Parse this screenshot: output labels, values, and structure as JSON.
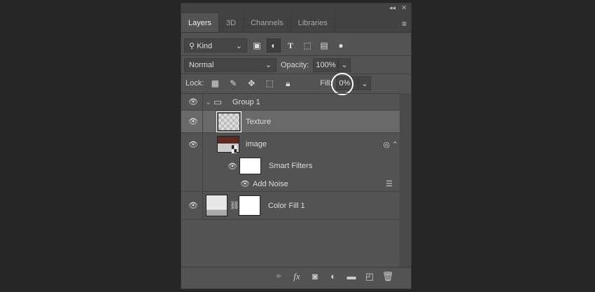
{
  "tabs": [
    "Layers",
    "3D",
    "Channels",
    "Libraries"
  ],
  "filter": {
    "kind_label": "Kind"
  },
  "blend": {
    "mode": "Normal",
    "opacity_label": "Opacity:",
    "opacity_value": "100%"
  },
  "lock": {
    "label": "Lock:",
    "fill_label": "Fill:",
    "fill_value": "0%"
  },
  "layers": [
    {
      "name": "Group 1",
      "type": "group",
      "visible": true
    },
    {
      "name": "Texture",
      "type": "pixel",
      "visible": true,
      "selected": true
    },
    {
      "name": "image",
      "type": "smart-object",
      "visible": true
    },
    {
      "name": "Smart Filters",
      "type": "smart-filters",
      "visible": true
    },
    {
      "name": "Add Noise",
      "type": "filter",
      "visible": true
    },
    {
      "name": "Color Fill 1",
      "type": "fill",
      "visible": true
    }
  ],
  "colors": {
    "panel": "#535353",
    "selected_row": "#696969",
    "background": "#262626",
    "highlight_circle": "#ffffff"
  }
}
